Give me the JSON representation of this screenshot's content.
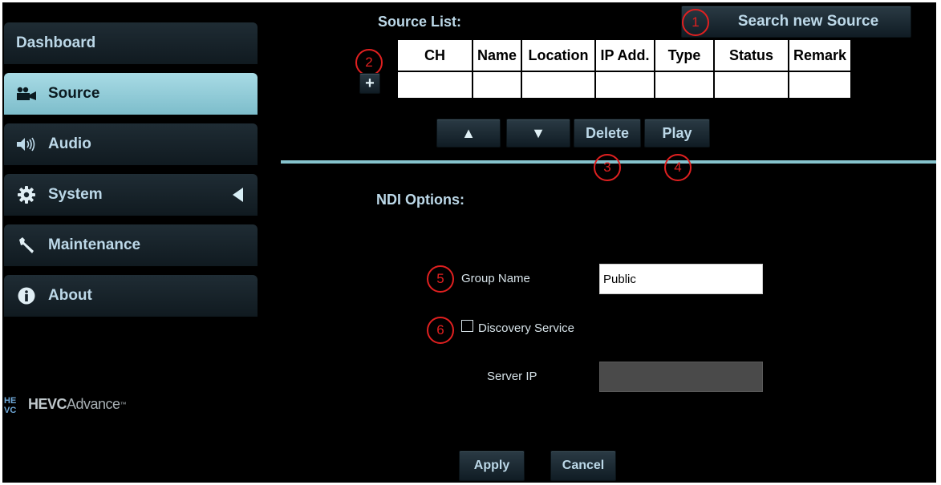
{
  "sidebar": {
    "items": [
      {
        "label": "Dashboard",
        "icon": "none"
      },
      {
        "label": "Source",
        "icon": "camera-icon",
        "active": true
      },
      {
        "label": "Audio",
        "icon": "speaker-icon"
      },
      {
        "label": "System",
        "icon": "gear-icon"
      },
      {
        "label": "Maintenance",
        "icon": "wrench-icon"
      },
      {
        "label": "About",
        "icon": "info-icon"
      }
    ],
    "brand": {
      "hevc": "HEVC",
      "advance": "Advance",
      "tm": "™"
    }
  },
  "source_list": {
    "title": "Source List:",
    "search_button": "Search new Source",
    "add_button": "+",
    "columns": [
      "CH",
      "Name",
      "Location",
      "IP Add.",
      "Type",
      "Status",
      "Remark"
    ],
    "rows": [
      [
        "",
        "",
        "",
        "",
        "",
        "",
        ""
      ]
    ],
    "up_button": "▲",
    "down_button": "▼",
    "delete_button": "Delete",
    "play_button": "Play"
  },
  "ndi_options": {
    "title": "NDI Options:",
    "group_name_label": "Group Name",
    "group_name_value": "Public",
    "discovery_label": "Discovery Service",
    "discovery_checked": false,
    "server_ip_label": "Server IP",
    "server_ip_value": "",
    "apply_button": "Apply",
    "cancel_button": "Cancel"
  },
  "markers": [
    "1",
    "2",
    "3",
    "4",
    "5",
    "6"
  ],
  "colors": {
    "accent": "#86c3cd",
    "active_nav": "#a8dbe5",
    "marker": "#e02020"
  }
}
